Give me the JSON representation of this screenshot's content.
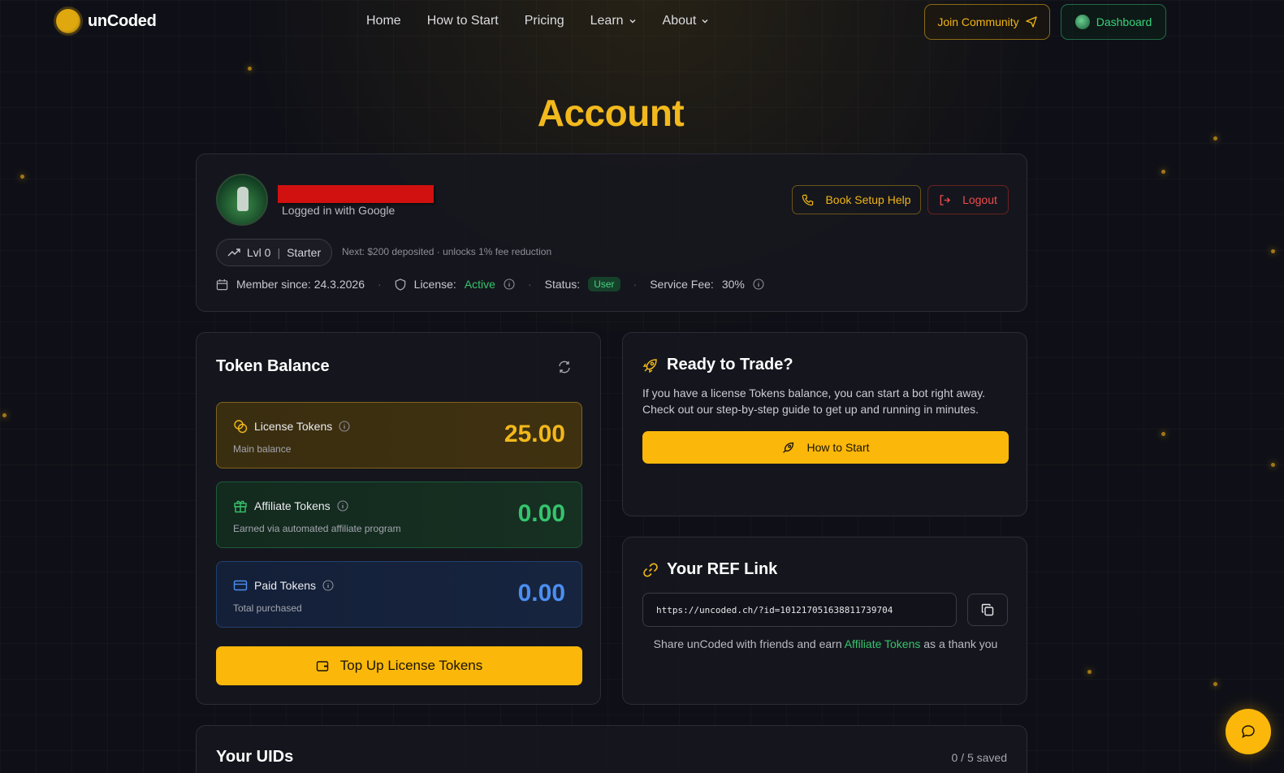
{
  "nav": {
    "brand": "unCoded",
    "links": [
      {
        "label": "Home"
      },
      {
        "label": "How to Start"
      },
      {
        "label": "Pricing"
      },
      {
        "label": "Learn"
      },
      {
        "label": "About"
      }
    ],
    "join_label": "Join Community",
    "dashboard_label": "Dashboard"
  },
  "page": {
    "title": "Account"
  },
  "profile": {
    "login_method": "Logged in with Google",
    "book_label": "Book Setup Help",
    "logout_label": "Logout",
    "level": "Lvl 0",
    "level_name": "Starter",
    "level_sep": "|",
    "next_level": "Next: $200 deposited · unlocks 1% fee reduction",
    "member_since": "Member since: 24.3.2026",
    "license_label": "License:",
    "license_value": "Active",
    "status_label": "Status:",
    "status_value": "User",
    "fee_label": "Service Fee:",
    "fee_value": "30%",
    "sep": "·"
  },
  "tokens": {
    "title": "Token Balance",
    "license": {
      "label": "License Tokens",
      "sub": "Main balance",
      "value": "25.00"
    },
    "affiliate": {
      "label": "Affiliate Tokens",
      "sub": "Earned via automated affiliate program",
      "value": "0.00"
    },
    "paid": {
      "label": "Paid Tokens",
      "sub": "Total purchased",
      "value": "0.00"
    },
    "topup_label": "Top Up License Tokens"
  },
  "ready": {
    "title": "Ready to Trade?",
    "text": "If you have a license Tokens balance, you can start a bot right away. Check out our step-by-step guide to get up and running in minutes.",
    "button": "How to Start"
  },
  "ref": {
    "title": "Your REF Link",
    "url": "https://uncoded.ch/?id=101217051638811739704",
    "note_pre": "Share unCoded with friends and earn ",
    "note_link": "Affiliate Tokens",
    "note_post": " as a thank you"
  },
  "uids": {
    "title": "Your UIDs",
    "count": "0 / 5 saved"
  },
  "colors": {
    "accent": "#fbb80a",
    "green": "#35c46d",
    "blue": "#4b8ef0",
    "red": "#ef4b4b",
    "bg": "#0f1017"
  },
  "icons": [
    "chevron-down-icon",
    "send-icon",
    "globe-icon",
    "phone-icon",
    "logout-icon",
    "trend-up-icon",
    "calendar-icon",
    "shield-icon",
    "info-icon",
    "refresh-icon",
    "coins-icon",
    "gift-icon",
    "card-icon",
    "wallet-icon",
    "rocket-icon",
    "link-icon",
    "copy-icon",
    "chat-icon"
  ]
}
